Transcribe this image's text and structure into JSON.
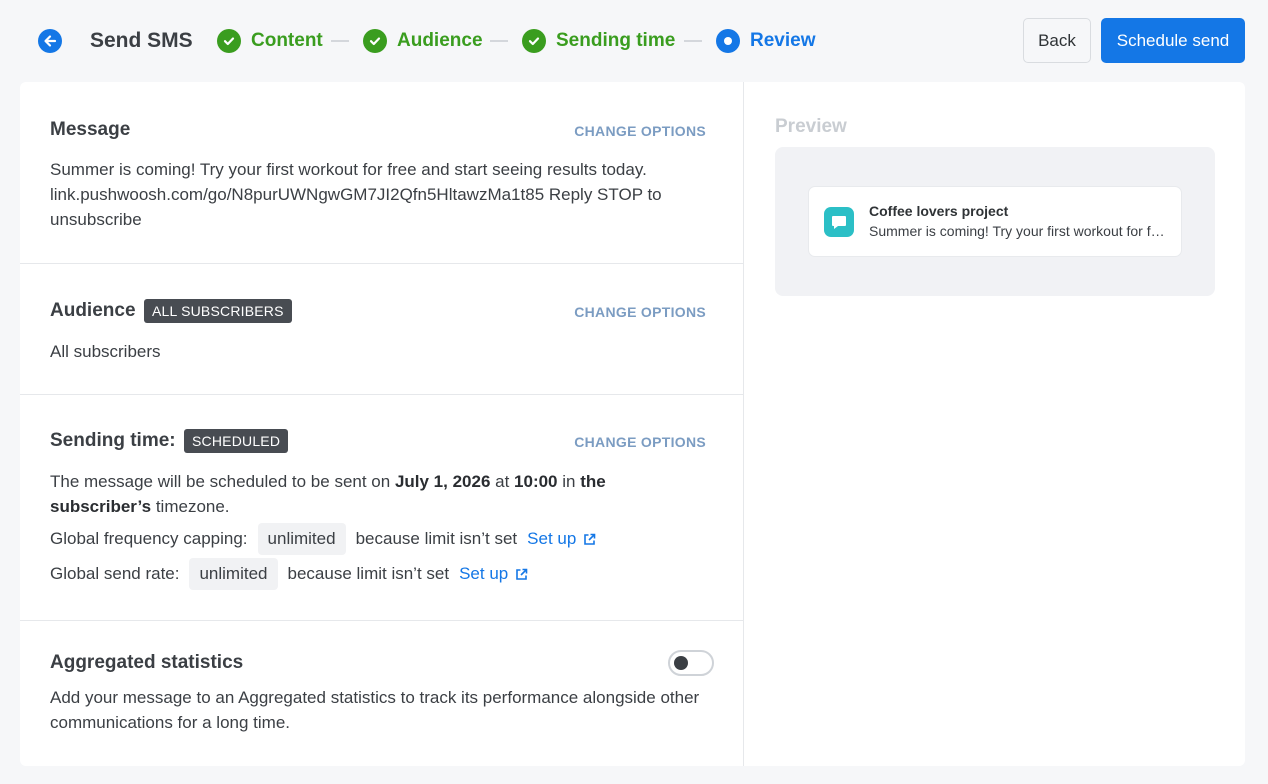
{
  "header": {
    "title": "Send SMS",
    "steps": [
      {
        "label": "Content",
        "state": "done"
      },
      {
        "label": "Audience",
        "state": "done"
      },
      {
        "label": "Sending time",
        "state": "done"
      },
      {
        "label": "Review",
        "state": "active"
      }
    ],
    "back_label": "Back",
    "schedule_label": "Schedule send"
  },
  "message": {
    "title": "Message",
    "change_label": "CHANGE OPTIONS",
    "text": "Summer is coming! Try your first workout for free and start seeing results today. link.pushwoosh.com/go/N8purUWNgwGM7JI2Qfn5HltawzMa1t85 Reply STOP to unsubscribe"
  },
  "audience": {
    "title": "Audience",
    "badge": "ALL SUBSCRIBERS",
    "change_label": "CHANGE OPTIONS",
    "text": "All subscribers"
  },
  "sending_time": {
    "title": "Sending time:",
    "badge": "SCHEDULED",
    "change_label": "CHANGE OPTIONS",
    "line_prefix": "The message will be scheduled to be sent on ",
    "date": "July 1, 2026",
    "at": " at ",
    "time": "10:00",
    "in": " in",
    "timezone_bold": "the subscriber’s",
    "timezone_suffix": " timezone.",
    "frequency_label": "Global frequency capping:",
    "frequency_value": "unlimited",
    "frequency_note": "because limit isn’t set",
    "rate_label": "Global send rate:",
    "rate_value": "unlimited",
    "rate_note": "because limit isn’t set",
    "setup_label": "Set up"
  },
  "aggregated": {
    "title": "Aggregated statistics",
    "text": "Add your message to an Aggregated statistics to track its performance alongside other communications for a long time.",
    "enabled": false
  },
  "preview": {
    "title": "Preview",
    "app_name": "Coffee lovers project",
    "snippet": "Summer is coming! Try your first workout for free and start seeing results today."
  },
  "colors": {
    "primary": "#1477e6",
    "success": "#3a9d1f",
    "badge": "#484c52",
    "change_link": "#7b9cc2",
    "sms_icon": "#2bbfc6"
  }
}
